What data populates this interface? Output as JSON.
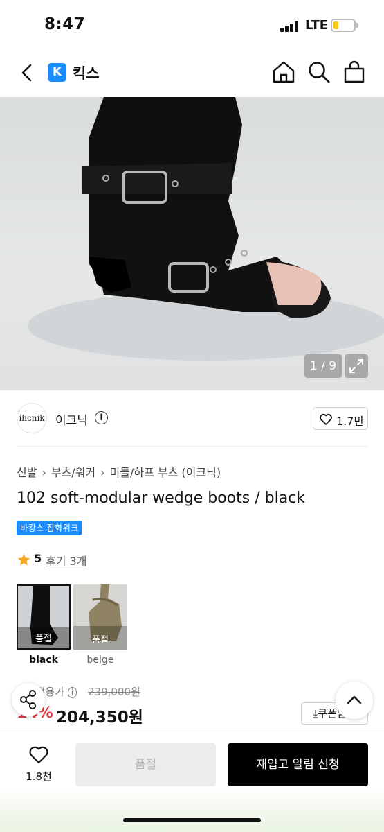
{
  "status_bar": {
    "time": "8:47",
    "network": "LTE"
  },
  "nav": {
    "brand_letter": "K",
    "brand_name": "킥스",
    "icons": [
      "back-icon",
      "home-icon",
      "search-icon",
      "bag-icon"
    ]
  },
  "gallery": {
    "counter": "1 / 9",
    "image_index": 1,
    "image_total": 9
  },
  "seller": {
    "logo_text": "ihcnik",
    "name": "이크닉",
    "likes": "1.7만"
  },
  "breadcrumb": [
    "신발",
    "부츠/워커",
    "미들/하프 부츠 (이크닉)"
  ],
  "product": {
    "title": "102 soft-modular wedge boots / black",
    "promo_badge": "바캉스 잡화위크",
    "rating": "5",
    "reviews": "후기 3개"
  },
  "colors": [
    {
      "label": "black",
      "status": "품절",
      "selected": true
    },
    {
      "label": "beige",
      "status": "품절",
      "selected": false
    }
  ],
  "price": {
    "label": "쿠폰적용가",
    "original": "239,000원",
    "discount": "14%",
    "sale": "204,350원",
    "coupon_label": "쿠폰받기"
  },
  "bottom_bar": {
    "wish_count": "1.8천",
    "soldout_label": "품절",
    "restock_label": "재입고 알림 신청"
  },
  "colors_theme": {
    "brand_blue": "#1a8cff",
    "discount_red": "#e8333c",
    "star": "#f5a623",
    "primary_button": "#000000"
  }
}
